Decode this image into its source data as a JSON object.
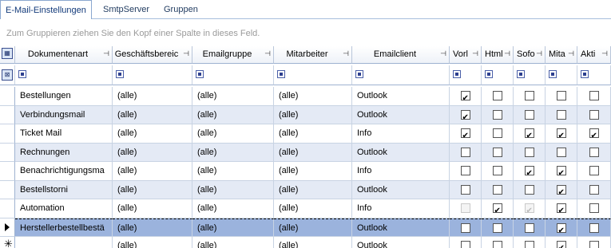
{
  "tabs": [
    "E-Mail-Einstellungen",
    "SmtpServer",
    "Gruppen"
  ],
  "group_hint": "Zum Gruppieren ziehen Sie den Kopf einer Spalte in dieses Feld.",
  "columns": [
    "Dokumentenart",
    "Geschäftsbereic",
    "Emailgruppe",
    "Mitarbeiter",
    "Emailclient",
    "Vorl",
    "Html",
    "Sofo",
    "Mita",
    "Akti"
  ],
  "pin_icon": "pin-icon",
  "rows": [
    {
      "doc": "Bestellungen",
      "ges": "(alle)",
      "grp": "(alle)",
      "mit": "(alle)",
      "client": "Outlook",
      "flags": [
        true,
        false,
        false,
        false,
        false
      ],
      "disabled": [
        false,
        false,
        false,
        false,
        false
      ]
    },
    {
      "doc": "Verbindungsmail",
      "ges": "(alle)",
      "grp": "(alle)",
      "mit": "(alle)",
      "client": "Outlook",
      "flags": [
        true,
        false,
        false,
        false,
        false
      ],
      "disabled": [
        false,
        false,
        false,
        false,
        false
      ]
    },
    {
      "doc": "Ticket Mail",
      "ges": "(alle)",
      "grp": "(alle)",
      "mit": "(alle)",
      "client": "Info",
      "flags": [
        true,
        false,
        true,
        true,
        true
      ],
      "disabled": [
        false,
        false,
        false,
        false,
        false
      ]
    },
    {
      "doc": "Rechnungen",
      "ges": "(alle)",
      "grp": "(alle)",
      "mit": "(alle)",
      "client": "Outlook",
      "flags": [
        false,
        false,
        false,
        false,
        false
      ],
      "disabled": [
        false,
        false,
        false,
        false,
        false
      ]
    },
    {
      "doc": "Benachrichtigungsma",
      "ges": "(alle)",
      "grp": "(alle)",
      "mit": "(alle)",
      "client": "Info",
      "flags": [
        false,
        false,
        true,
        true,
        false
      ],
      "disabled": [
        false,
        false,
        false,
        false,
        false
      ]
    },
    {
      "doc": "Bestellstorni",
      "ges": "(alle)",
      "grp": "(alle)",
      "mit": "(alle)",
      "client": "Outlook",
      "flags": [
        false,
        false,
        false,
        true,
        false
      ],
      "disabled": [
        false,
        false,
        false,
        false,
        false
      ]
    },
    {
      "doc": "Automation",
      "ges": "(alle)",
      "grp": "(alle)",
      "mit": "(alle)",
      "client": "Info",
      "flags": [
        false,
        true,
        true,
        true,
        false
      ],
      "disabled": [
        true,
        false,
        true,
        false,
        false
      ]
    },
    {
      "doc": "Herstellerbestellbestä",
      "ges": "(alle)",
      "grp": "(alle)",
      "mit": "(alle)",
      "client": "Outlook",
      "flags": [
        false,
        false,
        false,
        true,
        false
      ],
      "disabled": [
        false,
        false,
        false,
        false,
        false
      ],
      "current": true
    },
    {
      "doc": "",
      "ges": "(alle)",
      "grp": "(alle)",
      "mit": "(alle)",
      "client": "Outlook",
      "flags": [
        false,
        false,
        false,
        true,
        false
      ],
      "disabled": [
        false,
        false,
        false,
        false,
        false
      ],
      "new": true
    }
  ]
}
